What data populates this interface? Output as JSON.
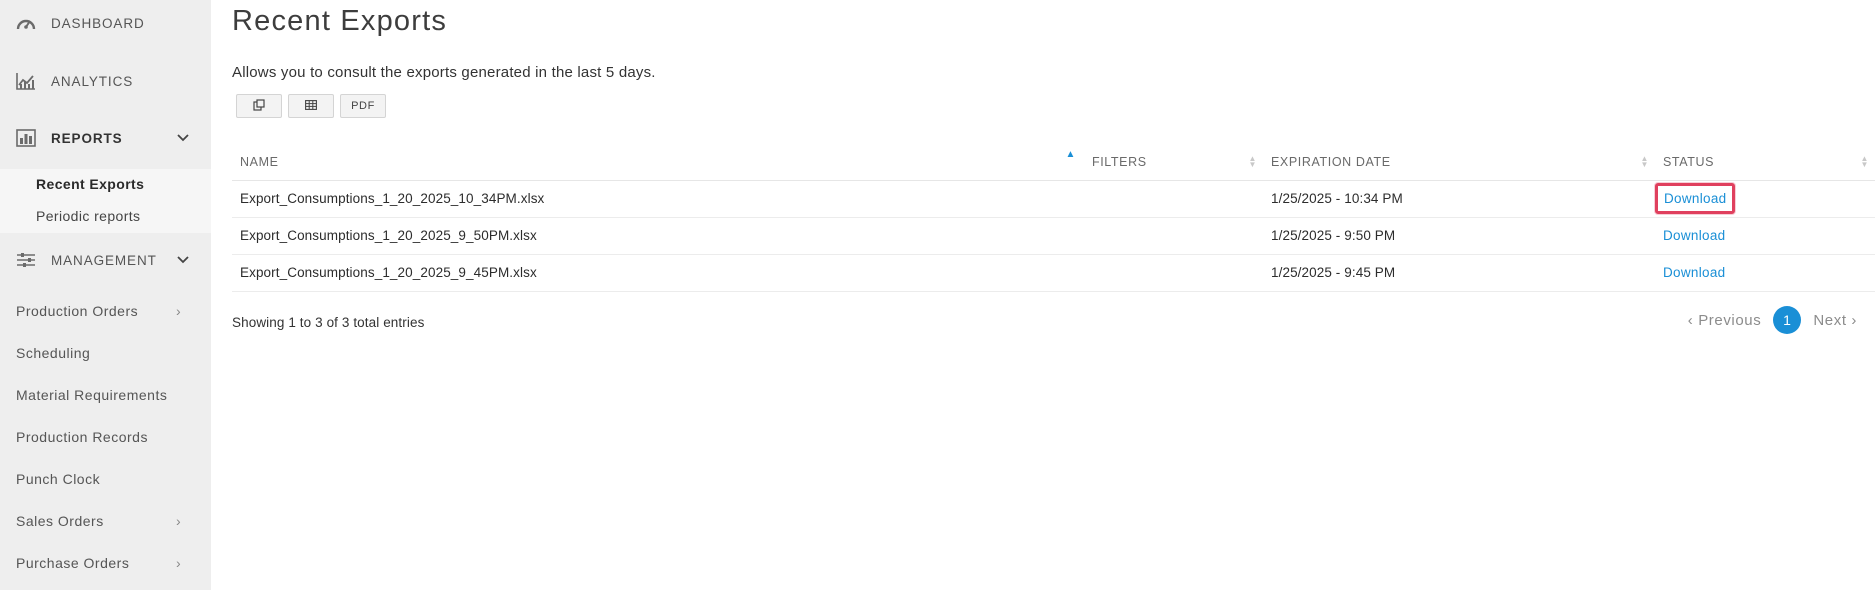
{
  "sidebar": {
    "sections": {
      "dashboard": {
        "label": "DASHBOARD",
        "icon": "speedometer-icon"
      },
      "analytics": {
        "label": "ANALYTICS",
        "icon": "line-chart-icon"
      },
      "reports": {
        "label": "REPORTS",
        "icon": "bar-chart-icon"
      },
      "management": {
        "label": "MANAGEMENT",
        "icon": "sliders-icon"
      }
    },
    "report_items": [
      "Recent Exports",
      "Periodic reports"
    ],
    "management_items": [
      "Production Orders",
      "Scheduling",
      "Material Requirements",
      "Production Records",
      "Punch Clock",
      "Sales Orders",
      "Purchase Orders"
    ]
  },
  "main": {
    "title": "Recent Exports",
    "subtitle": "Allows you to consult the exports generated in the last 5 days.",
    "buttons": {
      "copy_icon": "copy-icon",
      "table_icon": "table-icon",
      "pdf_label": "PDF"
    },
    "table": {
      "headers": [
        "NAME",
        "FILTERS",
        "EXPIRATION DATE",
        "STATUS"
      ],
      "rows": [
        {
          "name": "Export_Consumptions_1_20_2025_10_34PM.xlsx",
          "filters": "",
          "expiration": "1/25/2025 - 10:34 PM",
          "status": "Download"
        },
        {
          "name": "Export_Consumptions_1_20_2025_9_50PM.xlsx",
          "filters": "",
          "expiration": "1/25/2025 - 9:50 PM",
          "status": "Download"
        },
        {
          "name": "Export_Consumptions_1_20_2025_9_45PM.xlsx",
          "filters": "",
          "expiration": "1/25/2025 - 9:45 PM",
          "status": "Download"
        }
      ]
    },
    "info": "Showing 1 to 3 of 3 total entries",
    "pagination": {
      "previous": "Previous",
      "current": "1",
      "next": "Next"
    }
  },
  "colors": {
    "accent": "#1a8fd6",
    "highlight": "#e0405e",
    "sidebar_bg": "#eeeeee"
  }
}
